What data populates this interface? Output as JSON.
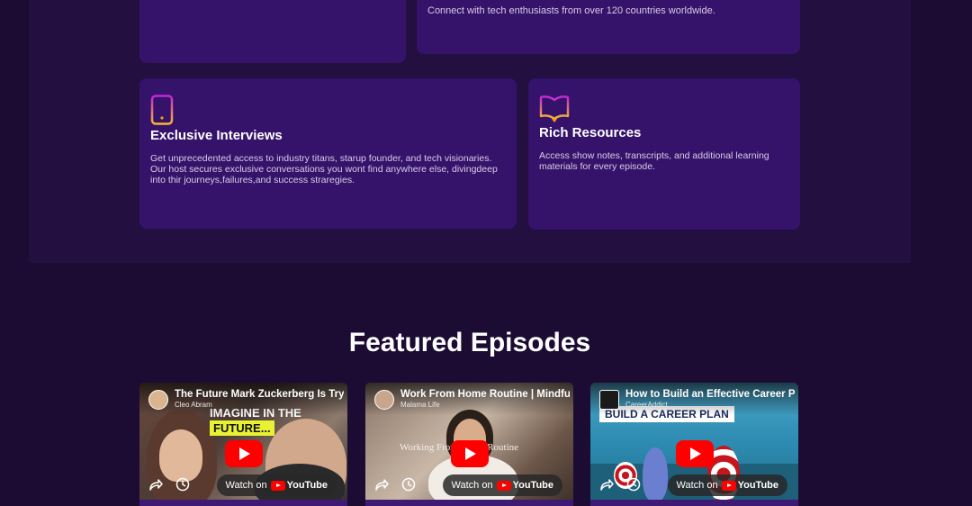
{
  "features": {
    "top_right_text": "Connect with tech enthusiasts from over 120 countries worldwide.",
    "interviews": {
      "title": "Exclusive Interviews",
      "description": "Get unprecedented access to industry titans, starup founder, and tech visionaries. Our host secures exclusive conversations you wont find anywhere else, divingdeep into thir journeys,failures,and success straregies.",
      "icon": "phone-icon"
    },
    "resources": {
      "title": "Rich Resources",
      "description": "Access show notes, transcripts, and additional learning materials for every episode.",
      "icon": "book-icon"
    }
  },
  "episodes": {
    "heading": "Featured Episodes",
    "watch_on_label": "Watch on",
    "youtube_label": "YouTube",
    "videos": [
      {
        "title": "The Future Mark Zuckerberg Is Trying To Build",
        "channel": "Cleo Abram",
        "thumb_text_1": "IMAGINE IN THE",
        "thumb_text_2": "FUTURE..."
      },
      {
        "title": "Work From Home Routine | Mindfulness",
        "channel": "Malama Life",
        "thumb_text_1": "Working From Home Routine"
      },
      {
        "title": "How to Build an Effective Career Plan",
        "channel": "CareerAddict",
        "thumb_text_1": "BUILD A CAREER PLAN"
      }
    ]
  },
  "colors": {
    "page_bg": "#1c0c33",
    "section_bg": "#230f40",
    "card_bg": "#35136a",
    "icon_gradient_start": "#f7b733",
    "icon_gradient_end": "#c026d3",
    "youtube_red": "#ff0000"
  }
}
